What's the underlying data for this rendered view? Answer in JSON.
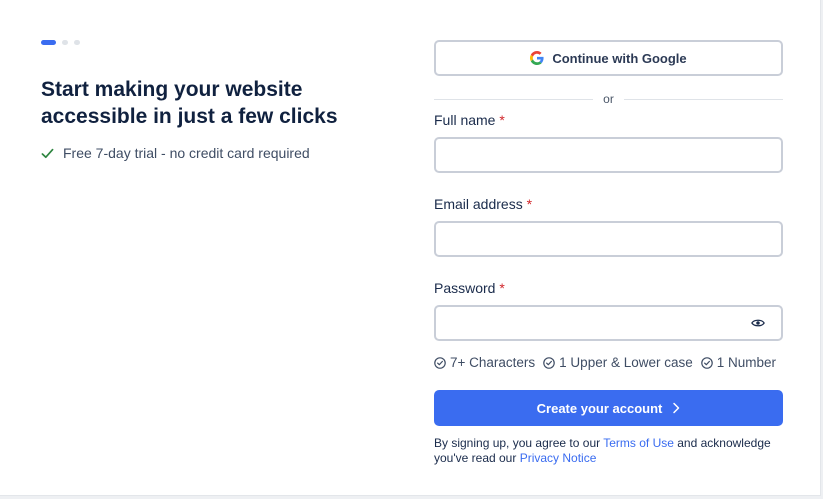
{
  "stepper": {
    "total": 3,
    "current": 1
  },
  "intro": {
    "headline": "Start making your website accessible in just a few clicks",
    "perk": "Free 7-day trial - no credit card required"
  },
  "form": {
    "google_label": "Continue with Google",
    "divider": "or",
    "fields": {
      "full_name": {
        "label": "Full name",
        "required": "*",
        "value": ""
      },
      "email": {
        "label": "Email address",
        "required": "*",
        "value": ""
      },
      "password": {
        "label": "Password",
        "required": "*",
        "value": ""
      }
    },
    "password_rules": [
      "7+ Characters",
      "1 Upper & Lower case",
      "1 Number"
    ],
    "submit_label": "Create your account",
    "legal": {
      "prefix": "By signing up, you agree to our ",
      "terms_link": "Terms of Use",
      "middle": " and acknowledge you've read our ",
      "privacy_link": "Privacy Notice"
    }
  },
  "icons": {
    "google": "google-icon",
    "check": "check-icon",
    "eye": "eye-icon",
    "rule": "check-circle-icon",
    "chevron": "chevron-right-icon"
  },
  "colors": {
    "primary": "#3a6cf0",
    "required": "#d1262b",
    "success": "#2e8540",
    "headline": "#10213f"
  }
}
